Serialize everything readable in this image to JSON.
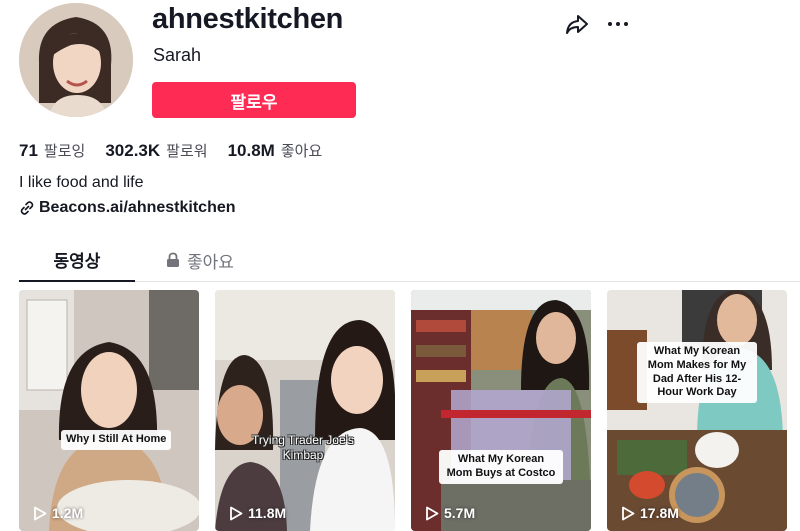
{
  "profile": {
    "username": "ahnestkitchen",
    "nickname": "Sarah",
    "follow_label": "팔로우",
    "bio": "I like food and life",
    "link": "Beacons.ai/ahnestkitchen"
  },
  "stats": [
    {
      "value": "71",
      "label": "팔로잉"
    },
    {
      "value": "302.3K",
      "label": "팔로워"
    },
    {
      "value": "10.8M",
      "label": "좋아요"
    }
  ],
  "tabs": {
    "videos_label": "동영상",
    "likes_label": "좋아요"
  },
  "videos": [
    {
      "caption": "Why I Still At Home",
      "views": "1.2M"
    },
    {
      "caption": "Trying Trader Joe's Kimbap",
      "views": "11.8M"
    },
    {
      "caption": "What My Korean Mom Buys at Costco",
      "views": "5.7M"
    },
    {
      "caption": "What My Korean Mom Makes for My Dad After His 12-Hour Work Day",
      "views": "17.8M"
    }
  ],
  "colors": {
    "accent": "#fe2c55",
    "text": "#161823",
    "muted": "#73747b"
  },
  "icons": [
    "share-icon",
    "more-icon",
    "link-icon",
    "lock-icon",
    "play-icon"
  ]
}
